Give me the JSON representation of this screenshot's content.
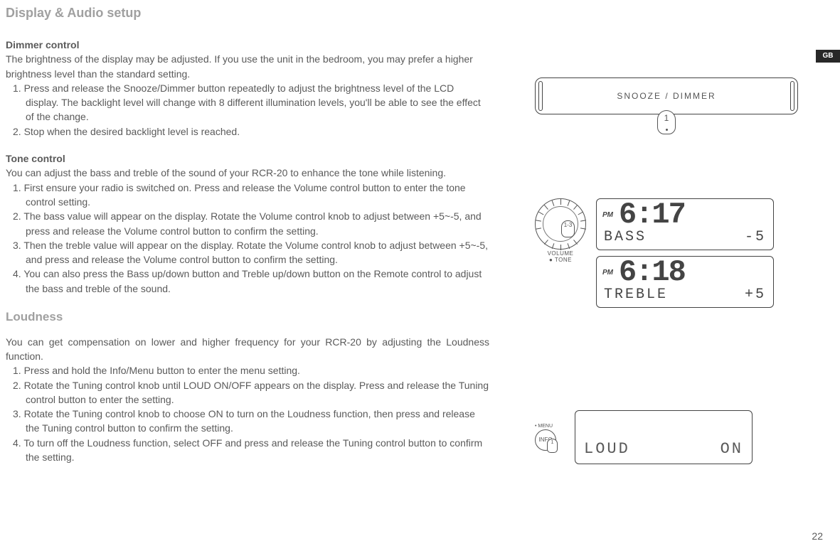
{
  "page_title": "Display & Audio setup",
  "gb_tab": "GB",
  "page_number": "22",
  "dimmer": {
    "heading": "Dimmer control",
    "intro": "The brightness of the display may be adjusted. If you use the unit in the bedroom, you may prefer a higher brightness level than the standard setting.",
    "step1": "1. Press and release the Snooze/Dimmer button repeatedly to adjust the brightness level of the LCD display. The backlight level will change with 8 different illumination levels, you'll be able to see the effect of the change.",
    "step2": "2. Stop when the desired backlight level is reached."
  },
  "tone": {
    "heading": "Tone control",
    "intro": "You can adjust the bass and treble of the sound of your RCR-20 to enhance the tone while listening.",
    "step1": "1. First ensure your radio is switched on. Press and release the Volume control button to enter the tone control setting.",
    "step2": "2. The bass value will appear on the display. Rotate the Volume control knob to adjust between +5~-5, and press and release the Volume control button to confirm the setting.",
    "step3": "3. Then the treble value will appear on the display. Rotate the Volume control knob to adjust between +5~-5, and press and release the Volume control button to confirm the setting.",
    "step4": "4. You can also press the Bass up/down button and Treble up/down button on the Remote control to adjust the bass and treble of the sound."
  },
  "loudness": {
    "heading": "Loudness",
    "intro": "You can get compensation on lower and higher frequency for your RCR-20 by adjusting the Loudness function.",
    "step1": "1. Press and hold the Info/Menu button to enter the menu setting.",
    "step2": "2. Rotate the Tuning control knob until LOUD ON/OFF appears on the display. Press and release the Tuning control button to enter the setting.",
    "step3": "3. Rotate the Tuning control knob to choose ON to turn on the Loudness function, then press and release the Tuning control button to confirm the setting.",
    "step4": "4. To turn off the Loudness function, select OFF and press and release the Tuning control button to confirm the setting."
  },
  "illus": {
    "snooze_label": "SNOOZE / DIMMER",
    "snooze_callout": "1",
    "vol_callout": "1-3",
    "vol_label_1": "VOLUME",
    "vol_label_2": "● TONE",
    "lcd1": {
      "pm": "PM",
      "time": "6:17",
      "line": "BASS",
      "val": "-5"
    },
    "lcd2": {
      "pm": "PM",
      "time": "6:18",
      "line": "TREBLE",
      "val": "+5"
    },
    "info_menu": "• MENU",
    "info_label": "INFO",
    "info_callout": "1",
    "loud_line": "LOUD",
    "loud_val": "ON"
  }
}
